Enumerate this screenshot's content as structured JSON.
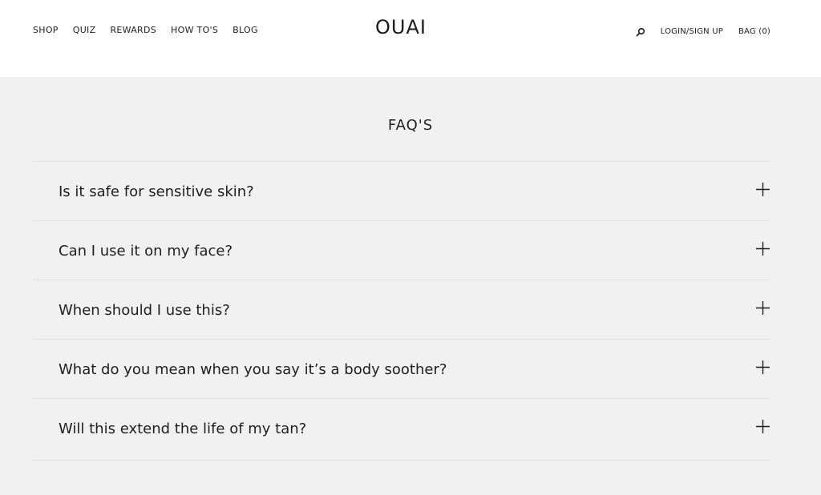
{
  "header": {
    "nav_left": [
      "SHOP",
      "QUIZ",
      "REWARDS",
      "HOW TO'S",
      "BLOG"
    ],
    "logo": "OUAI",
    "search_icon": "search-icon",
    "login_label": "LOGIN/SIGN UP",
    "bag_label": "BAG (0)"
  },
  "faq": {
    "title": "FAQ'S",
    "expand_icon": "plus-icon",
    "items": [
      {
        "question": "Is it safe for sensitive skin?"
      },
      {
        "question": "Can I use it on my face?"
      },
      {
        "question": "When should I use this?"
      },
      {
        "question": "What do you mean when you say it’s a body soother?"
      },
      {
        "question": "Will this extend the life of my tan?"
      }
    ]
  },
  "colors": {
    "page_background": "#ffffff",
    "faq_background": "#f1f1f1",
    "divider": "#e0e0e0",
    "text": "#1f1f1f"
  }
}
